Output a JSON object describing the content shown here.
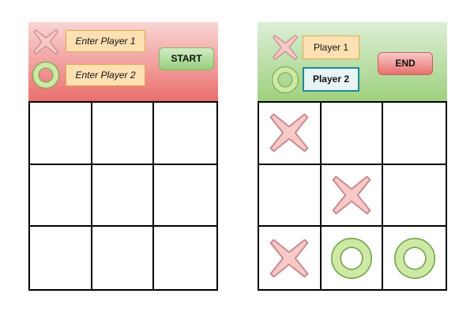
{
  "setup_screen": {
    "player1_placeholder": "Enter Player 1",
    "player2_placeholder": "Enter Player 2",
    "start_label": "START",
    "player1_marker": "x",
    "player2_marker": "o",
    "board": [
      "",
      "",
      "",
      "",
      "",
      "",
      "",
      "",
      ""
    ]
  },
  "game_screen": {
    "player1_name": "Player 1",
    "player2_name": "Player 2",
    "active_player": 2,
    "end_label": "END",
    "player1_marker": "x",
    "player2_marker": "o",
    "board": [
      "x",
      "",
      "",
      "",
      "x",
      "",
      "x",
      "o",
      "o"
    ]
  },
  "icons": {
    "x": "x-mark-icon",
    "o": "o-mark-icon"
  },
  "colors": {
    "x_fill": "#f7c9c8",
    "x_stroke": "#c98a8a",
    "o_fill": "#cfe8a6",
    "o_stroke": "#6fa84a",
    "setup_header_top": "#f8d6d4",
    "setup_header_bottom": "#ea6f6c",
    "game_header_top": "#dcefd5",
    "game_header_bottom": "#9fd07f",
    "name_field_bg": "#ffe0b3",
    "active_field_border": "#1d8a97"
  }
}
